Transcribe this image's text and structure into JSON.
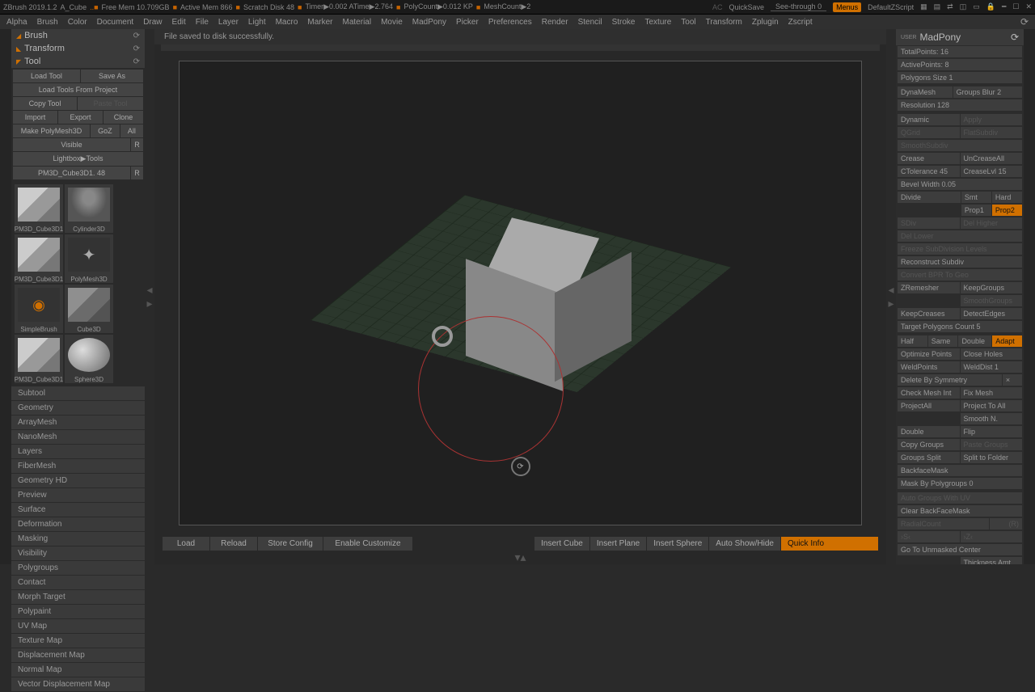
{
  "titlebar": {
    "app": "ZBrush 2019.1.2",
    "doc": "A_Cube",
    "mem": "Free Mem 10.709GB",
    "active": "Active Mem 866",
    "scratch": "Scratch Disk 48",
    "timer": "Timer▶0.002 ATime▶2.764",
    "poly": "PolyCount▶0.012 KP",
    "mesh": "MeshCount▶2",
    "ac": "AC",
    "quicksave": "QuickSave",
    "seethrough": "See-through  0",
    "menus": "Menus",
    "default": "DefaultZScript"
  },
  "menu": [
    "Alpha",
    "Brush",
    "Color",
    "Document",
    "Draw",
    "Edit",
    "File",
    "Layer",
    "Light",
    "Macro",
    "Marker",
    "Material",
    "Movie",
    "MadPony",
    "Picker",
    "Preferences",
    "Render",
    "Stencil",
    "Stroke",
    "Texture",
    "Tool",
    "Transform",
    "Zplugin",
    "Zscript"
  ],
  "left": {
    "brush": "Brush",
    "transform": "Transform",
    "tool": "Tool",
    "buttons": {
      "load": "Load Tool",
      "saveas": "Save As",
      "loadproj": "Load Tools From Project",
      "copy": "Copy Tool",
      "paste": "Paste Tool",
      "import": "Import",
      "export": "Export",
      "clone": "Clone",
      "makepoly": "Make PolyMesh3D",
      "goz": "GoZ",
      "all": "All",
      "visible": "Visible",
      "r": "R",
      "lightbox": "Lightbox▶Tools",
      "current": "PM3D_Cube3D1. 48"
    },
    "swatches": [
      "PM3D_Cube3D1",
      "Cylinder3D",
      "PM3D_Cube3D1",
      "PolyMesh3D",
      "SimpleBrush",
      "Cube3D",
      "PM3D_Cube3D1",
      "Sphere3D"
    ],
    "accordion": [
      "Subtool",
      "Geometry",
      "ArrayMesh",
      "NanoMesh",
      "Layers",
      "FiberMesh",
      "Geometry HD",
      "Preview",
      "Surface",
      "Deformation",
      "Masking",
      "Visibility",
      "Polygroups",
      "Contact",
      "Morph Target",
      "Polypaint",
      "UV Map",
      "Texture Map",
      "Displacement Map",
      "Normal Map",
      "Vector Displacement Map"
    ]
  },
  "info_line": "File saved to disk successfully.",
  "bottom": {
    "load": "Load",
    "reload": "Reload",
    "store": "Store Config",
    "enable": "Enable Customize",
    "icube": "Insert Cube",
    "iplane": "Insert Plane",
    "isphere": "Insert Sphere",
    "autohide": "Auto Show/Hide",
    "quick": "Quick Info"
  },
  "right": {
    "title": "MadPony",
    "totalpts": "TotalPoints: 16",
    "activepts": "ActivePoints: 8",
    "polysize": "Polygons Size 1",
    "dynamesh": "DynaMesh",
    "groupsblur": "Groups  Blur 2",
    "resolution": "Resolution 128",
    "dynamic": "Dynamic",
    "apply": "Apply",
    "qgrid": "QGrid",
    "flatsubd": "FlatSubdiv",
    "smoothsubd": "SmoothSubdiv",
    "crease": "Crease",
    "uncrease": "UnCreaseAll",
    "ctol": "CTolerance 45",
    "creaselvl": "CreaseLvl 15",
    "bevel": "Bevel Width 0.05",
    "divide": "Divide",
    "smt": "Smt",
    "hard": "Hard",
    "prop1": "Prop1",
    "prop2": "Prop2",
    "sdiv": "SDiv",
    "delhigher": "Del Higher",
    "dellower": "Del Lower",
    "freeze": "Freeze SubDivision Levels",
    "reconstruct": "Reconstruct Subdiv",
    "convertbpr": "Convert BPR To Geo",
    "zremesh": "ZRemesher",
    "keepgroups": "KeepGroups",
    "smoothgroups": "SmoothGroups",
    "keepcrease": "KeepCreases",
    "detectedge": "DetectEdges",
    "target": "Target Polygons Count 5",
    "half": "Half",
    "same": "Same",
    "double": "Double",
    "adapt": "Adapt",
    "optimize": "Optimize Points",
    "closeholes": "Close Holes",
    "weldpts": "WeldPoints",
    "welddist": "WeldDist 1",
    "delsym": "Delete By Symmetry",
    "checkmesh": "Check Mesh Int",
    "fixmesh": "Fix Mesh",
    "projall": "ProjectAll",
    "projtoall": "Project To All",
    "smoothn": "Smooth N.",
    "double2": "Double",
    "flip": "Flip",
    "copygroups": "Copy Groups",
    "pastegroups": "Paste Groups",
    "groupssplit": "Groups Split",
    "splitfolder": "Split to Folder",
    "backface": "BackfaceMask",
    "maskpoly": "Mask By Polygroups 0",
    "autouv": "Auto Groups With UV",
    "clearbf": "Clear BackFaceMask",
    "radial": "RadialCount",
    "rr": "(R)",
    "gounmask": "Go To Unmasked Center",
    "thickness": "Thickness Amt"
  }
}
